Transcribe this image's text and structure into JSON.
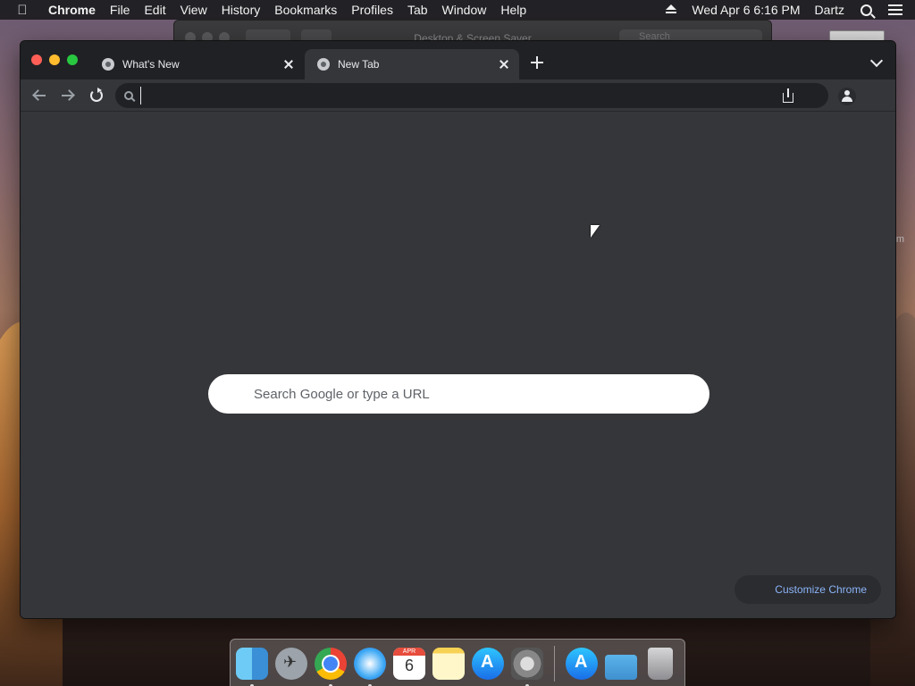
{
  "menubar": {
    "apple_icon": "apple-icon",
    "app_name": "Chrome",
    "items": [
      "File",
      "Edit",
      "View",
      "History",
      "Bookmarks",
      "Profiles",
      "Tab",
      "Window",
      "Help"
    ],
    "datetime": "Wed Apr 6  6:16 PM",
    "user": "Dartz"
  },
  "background_window": {
    "title": "Desktop & Screen Saver",
    "search_placeholder": "Search"
  },
  "desktop": {
    "side_text": "m"
  },
  "chrome": {
    "tabs": [
      {
        "title": "What's New",
        "active": false
      },
      {
        "title": "New Tab",
        "active": true
      }
    ],
    "omnibox": {
      "value": "",
      "placeholder": ""
    },
    "ntp_search_placeholder": "Search Google or type a URL",
    "customize_label": "Customize Chrome"
  },
  "dock": {
    "calendar_month": "APR",
    "calendar_day": "6",
    "apps": [
      "finder",
      "launchpad",
      "chrome",
      "safari",
      "calendar",
      "notes",
      "app-store",
      "system-preferences",
      "downloads",
      "documents-folder",
      "trash"
    ]
  }
}
